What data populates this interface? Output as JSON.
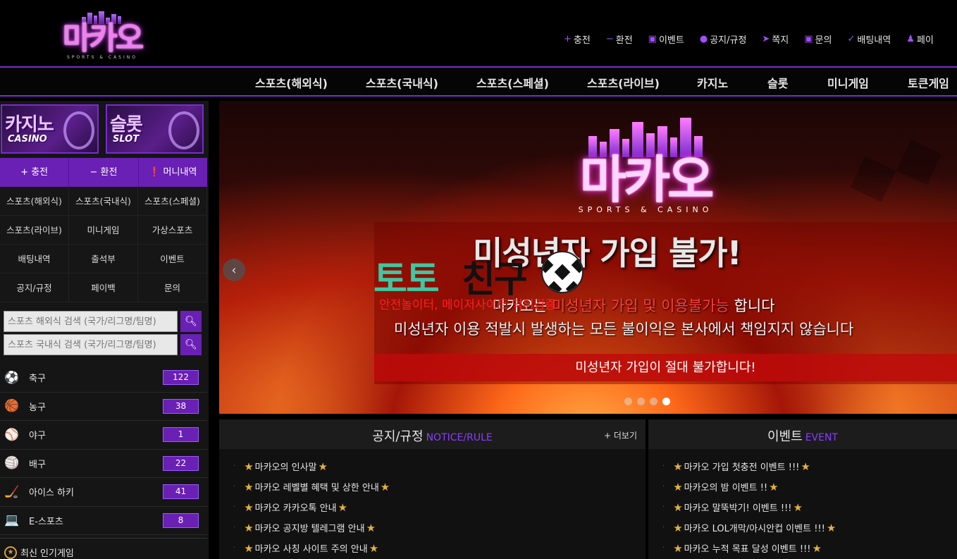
{
  "brand": {
    "logo_text": "마카오",
    "logo_sub": "SPORTS & CASINO"
  },
  "top_links": [
    {
      "icon": "plus-icon",
      "glyph": "+",
      "label": "충전"
    },
    {
      "icon": "minus-icon",
      "glyph": "−",
      "label": "환전"
    },
    {
      "icon": "calendar-icon",
      "glyph": "▣",
      "label": "이벤트"
    },
    {
      "icon": "info-icon",
      "glyph": "●",
      "label": "공지/규정"
    },
    {
      "icon": "send-icon",
      "glyph": "➤",
      "label": "쪽지"
    },
    {
      "icon": "question-icon",
      "glyph": "▣",
      "label": "문의"
    },
    {
      "icon": "check-icon",
      "glyph": "✓",
      "label": "배팅내역"
    },
    {
      "icon": "user-icon",
      "glyph": "♟",
      "label": "페이"
    }
  ],
  "main_nav": [
    "스포츠(해외식)",
    "스포츠(국내식)",
    "스포츠(스페셜)",
    "스포츠(라이브)",
    "카지노",
    "슬롯",
    "미니게임",
    "토큰게임"
  ],
  "sidebar": {
    "promos": [
      {
        "title": "카지노",
        "subtitle": "CASINO"
      },
      {
        "title": "슬롯",
        "subtitle": "SLOT"
      }
    ],
    "money_buttons": [
      "+ 충전",
      "− 환전",
      "❗ 머니내역"
    ],
    "menu": [
      "스포츠(해외식)",
      "스포츠(국내식)",
      "스포츠(스페셜)",
      "스포츠(라이브)",
      "미니게임",
      "가상스포츠",
      "배팅내역",
      "출석부",
      "이벤트",
      "공지/규정",
      "페이백",
      "문의"
    ],
    "search_overseas": {
      "placeholder": "스포츠 해외식 검색 (국가/리그명/팀명)"
    },
    "search_domestic": {
      "placeholder": "스포츠 국내식 검색 (국가/리그명/팀명)"
    },
    "sports": [
      {
        "icon": "soccer-icon",
        "glyph": "⚽",
        "name": "축구",
        "count": "122"
      },
      {
        "icon": "basketball-icon",
        "glyph": "🏀",
        "name": "농구",
        "count": "38"
      },
      {
        "icon": "baseball-icon",
        "glyph": "⚾",
        "name": "야구",
        "count": "1"
      },
      {
        "icon": "volleyball-icon",
        "glyph": "🏐",
        "name": "배구",
        "count": "22"
      },
      {
        "icon": "hockey-icon",
        "glyph": "🏒",
        "name": "아이스 하키",
        "count": "41"
      },
      {
        "icon": "esports-icon",
        "glyph": "💻",
        "name": "E-스포츠",
        "count": "8"
      }
    ],
    "popular_label": "최신 인기게임"
  },
  "banner": {
    "logo_text": "마카오",
    "logo_sub": "SPORTS & CASINO",
    "headline": "미성년자 가입 불가!",
    "line1_prefix": "마카오는 ",
    "line1_highlight": "미성년자 가입 및 이용불가능",
    "line1_suffix": " 합니다",
    "line2": "미성년자 이용 적발시 발생하는 모든 불이익은 본사에서 책임지지 않습니다",
    "cta": "미성년자 가입이 절대 불가합니다!",
    "slide_count": 4,
    "active_slide": 4
  },
  "watermark": {
    "word1": "토토",
    "word2": "친구",
    "tagline": "안전놀이터, 메이저사이트 먹튀검증"
  },
  "notice_board": {
    "title": "공지/규정",
    "title_en": "NOTICE/RULE",
    "more": "+ 더보기",
    "items": [
      "마카오의 인사말",
      "마카오 레벨별 혜택 및 상한 안내",
      "마카오 카카오톡 안내",
      "마카오 공지방 텔레그램 안내",
      "마카오 사칭 사이트 주의 안내"
    ]
  },
  "event_board": {
    "title": "이벤트",
    "title_en": "EVENT",
    "items": [
      "마카오 가입 첫충전 이벤트 !!!",
      "마카오의 밤 이벤트 !!",
      "마카오 말뚝박기! 이벤트 !!!",
      "마카오 LOL개막/아시안컵 이벤트 !!!",
      "마카오 누적 목표 달성 이벤트 !!!"
    ]
  },
  "colors": {
    "accent": "#6a1fb5",
    "accent_line": "#7a2bd0",
    "star": "#e3b23c",
    "warning": "#ff3d3d"
  }
}
